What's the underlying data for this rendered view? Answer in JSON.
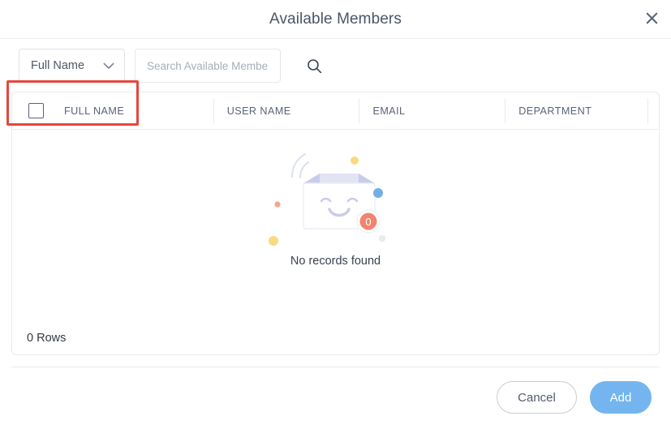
{
  "dialog": {
    "title": "Available Members",
    "close_icon": "close-icon"
  },
  "toolbar": {
    "filter_select": {
      "value": "Full Name",
      "chevron_icon": "chevron-down-icon"
    },
    "search": {
      "value": "",
      "placeholder": "Search Available Member"
    },
    "search_icon": "search-icon",
    "highlight_color": "#e8453c"
  },
  "table": {
    "select_all_checkbox": {
      "checked": false
    },
    "columns": [
      {
        "label": "FULL NAME"
      },
      {
        "label": "USER NAME"
      },
      {
        "label": "EMAIL"
      },
      {
        "label": "DEPARTMENT"
      }
    ],
    "rows": [],
    "empty_state": {
      "message": "No records found",
      "badge_count": "0",
      "illustration": "empty-box-icon"
    },
    "rows_count_label": "0 Rows"
  },
  "footer": {
    "cancel_label": "Cancel",
    "add_label": "Add",
    "add_button_color": "#74b5ef"
  }
}
